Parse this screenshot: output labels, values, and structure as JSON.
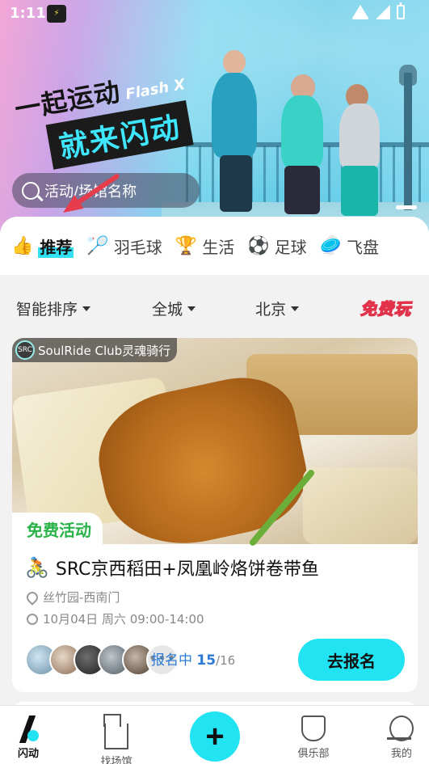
{
  "status_bar": {
    "time": "1:11",
    "app_icon": "flash-app-mini-icon"
  },
  "banner": {
    "slogan_line1": "一起运动",
    "slogan_brand": "Flash X",
    "slogan_line2": "就来闪动",
    "search_placeholder": "活动/场馆名称"
  },
  "tabs": [
    {
      "emoji": "👍",
      "label": "推荐",
      "active": true
    },
    {
      "emoji": "🏸",
      "label": "羽毛球",
      "active": false
    },
    {
      "emoji": "🏆",
      "label": "生活",
      "active": false
    },
    {
      "emoji": "⚽",
      "label": "足球",
      "active": false
    },
    {
      "emoji": "🥏",
      "label": "飞盘",
      "active": false
    }
  ],
  "filters": {
    "sort": "智能排序",
    "area": "全城",
    "city": "北京",
    "free_play": "免费玩"
  },
  "card": {
    "club_name": "SoulRide Club灵魂骑行",
    "club_logo_text": "SRC",
    "tag": "免费活动",
    "title_emoji": "🚴",
    "title": "SRC京西稻田+凤凰岭烙饼卷带鱼",
    "location": "丝竹园-西南门",
    "time": "10月04日 周六 09:00-14:00",
    "more_avatars": "•••",
    "status_label": "报名中",
    "signed_count": "15",
    "capacity": "/16",
    "signup_button": "去报名"
  },
  "bottom_nav": {
    "items": [
      {
        "label": "闪动",
        "icon": "bolt-icon",
        "active": true
      },
      {
        "label": "找场馆",
        "icon": "venue-icon",
        "active": false
      },
      {
        "label": "俱乐部",
        "icon": "club-shield-icon",
        "active": false
      },
      {
        "label": "我的",
        "icon": "profile-icon",
        "active": false
      }
    ],
    "fab_label": "+"
  },
  "colors": {
    "accent": "#22e3f2",
    "annotation_arrow": "#e63c4c",
    "free_green": "#29b248",
    "status_blue": "#2b7bd6"
  }
}
